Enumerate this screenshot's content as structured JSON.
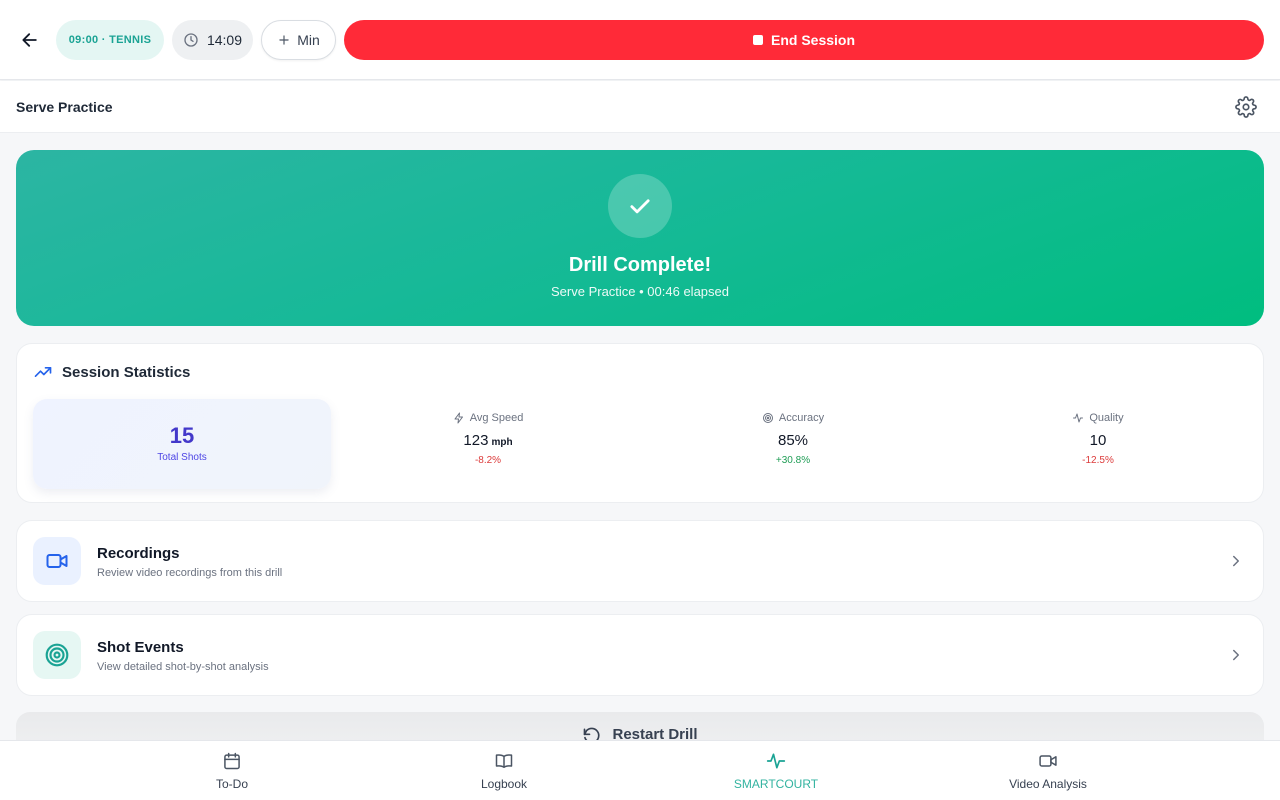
{
  "topbar": {
    "sport_label": "09:00 · TENNIS",
    "timer": "14:09",
    "add_min_label": "Min",
    "end_session_label": "End Session"
  },
  "subheader": {
    "title": "Serve Practice"
  },
  "hero": {
    "title": "Drill Complete!",
    "subtitle": "Serve Practice • 00:46 elapsed"
  },
  "stats": {
    "title": "Session Statistics",
    "total_shots": {
      "value": "15",
      "label": "Total Shots"
    },
    "items": [
      {
        "icon": "zap-icon",
        "label": "Avg Speed",
        "value": "123",
        "unit": "mph",
        "delta": "-8.2%",
        "trend": "negative"
      },
      {
        "icon": "target-icon",
        "label": "Accuracy",
        "value": "85%",
        "unit": "",
        "delta": "+30.8%",
        "trend": "positive"
      },
      {
        "icon": "activity-icon",
        "label": "Quality",
        "value": "10",
        "unit": "",
        "delta": "-12.5%",
        "trend": "negative"
      }
    ]
  },
  "actions": [
    {
      "icon": "video-icon",
      "title": "Recordings",
      "subtitle": "Review video recordings from this drill"
    },
    {
      "icon": "target-icon",
      "title": "Shot Events",
      "subtitle": "View detailed shot-by-shot analysis"
    }
  ],
  "restart_label": "Restart Drill",
  "nav": {
    "items": [
      {
        "icon": "calendar-icon",
        "label": "To-Do"
      },
      {
        "icon": "book-icon",
        "label": "Logbook"
      },
      {
        "icon": "pulse-icon",
        "label": "SMARTCOURT",
        "active": true
      },
      {
        "icon": "video-icon",
        "label": "Video Analysis"
      }
    ]
  },
  "colors": {
    "accent_teal": "#1aa394",
    "danger_red": "#ff2a38",
    "hero_start": "#2cb5a3",
    "hero_end": "#00bd7f",
    "indigo": "#4338ca",
    "positive": "#1f9d55",
    "negative": "#dc3b3b"
  }
}
